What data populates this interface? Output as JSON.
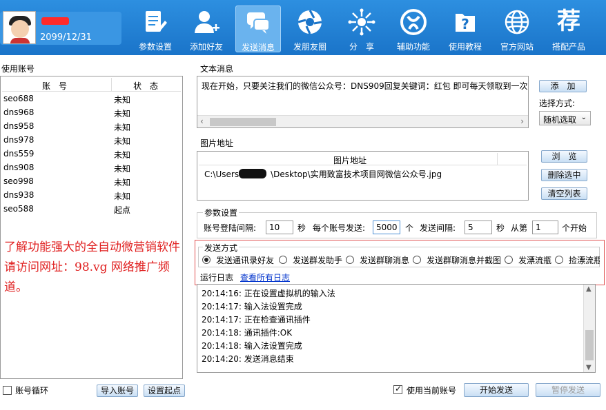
{
  "user": {
    "expiry": "2099/12/31"
  },
  "nav": [
    {
      "label": "参数设置",
      "icon": "document-edit-icon"
    },
    {
      "label": "添加好友",
      "icon": "add-user-icon"
    },
    {
      "label": "发送消息",
      "icon": "chat-bubbles-icon",
      "active": true
    },
    {
      "label": "发朋友圈",
      "icon": "aperture-icon"
    },
    {
      "label": "分　享",
      "icon": "share-burst-icon"
    },
    {
      "label": "辅助功能",
      "icon": "helper-circle-icon"
    },
    {
      "label": "使用教程",
      "icon": "help-folder-icon"
    },
    {
      "label": "官方网站",
      "icon": "globe-icon"
    },
    {
      "label": "搭配产品",
      "icon": "recommend-icon",
      "glyph": "荐"
    }
  ],
  "accounts": {
    "section_label": "使用账号",
    "col_account": "账　号",
    "col_status": "状　态",
    "rows": [
      {
        "name": "seo688",
        "status": "未知"
      },
      {
        "name": "dns968",
        "status": "未知"
      },
      {
        "name": "dns958",
        "status": "未知"
      },
      {
        "name": "dns978",
        "status": "未知"
      },
      {
        "name": "dns559",
        "status": "未知"
      },
      {
        "name": "dns908",
        "status": "未知"
      },
      {
        "name": "seo998",
        "status": "未知"
      },
      {
        "name": "dns938",
        "status": "未知"
      },
      {
        "name": "seo588",
        "status": "起点"
      }
    ],
    "loop_label": "账号循环",
    "import_label": "导入账号",
    "set_start_label": "设置起点"
  },
  "promo": "了解功能强大的全自动微营销软件请访问网址：98.vg 网络推广频道。",
  "text_message": {
    "label": "文本消息",
    "content": "现在开始，只要关注我们的微信公众号：DNS909回复关键词：红包 即可每天领取到一次",
    "add_label": "添　加",
    "select_mode_label": "选择方式:",
    "select_value": "随机选取"
  },
  "image": {
    "label": "图片地址",
    "column": "图片地址",
    "path_prefix": "C:\\Users\\",
    "path_suffix": "\\Desktop\\实用致富技术项目网微信公众号.jpg",
    "browse_label": "浏　览",
    "delete_label": "删除选中",
    "clear_label": "清空列表"
  },
  "params": {
    "label": "参数设置",
    "login_interval_label": "账号登陆间隔:",
    "login_interval": "10",
    "sec1": "秒",
    "per_account_label": "每个账号发送:",
    "per_account": "5000",
    "unit": "个",
    "send_interval_label": "发送间隔:",
    "send_interval": "5",
    "sec2": "秒",
    "from_label": "从第",
    "from_value": "1",
    "start_label": "个开始"
  },
  "send_mode": {
    "label": "发送方式",
    "options": [
      {
        "label": "发送通讯录好友",
        "selected": true
      },
      {
        "label": "发送群发助手",
        "selected": false
      },
      {
        "label": "发送群聊消息",
        "selected": false
      },
      {
        "label": "发送群聊消息并截图",
        "selected": false
      },
      {
        "label": "发漂流瓶",
        "selected": false
      },
      {
        "label": "捡漂流瓶",
        "selected": false
      }
    ]
  },
  "log": {
    "label": "运行日志",
    "view_all": "查看所有日志",
    "lines": [
      "20:14:16:  正在设置虚拟机的输入法",
      "20:14:17:  输入法设置完成",
      "20:14:17:  正在检查通讯插件",
      "20:14:18:  通讯插件:OK",
      "20:14:18:  输入法设置完成",
      "20:14:20:  发送消息结束"
    ]
  },
  "footer": {
    "use_current_label": "使用当前账号",
    "use_current_checked": true,
    "start_label": "开始发送",
    "pause_label": "暂停发送"
  }
}
